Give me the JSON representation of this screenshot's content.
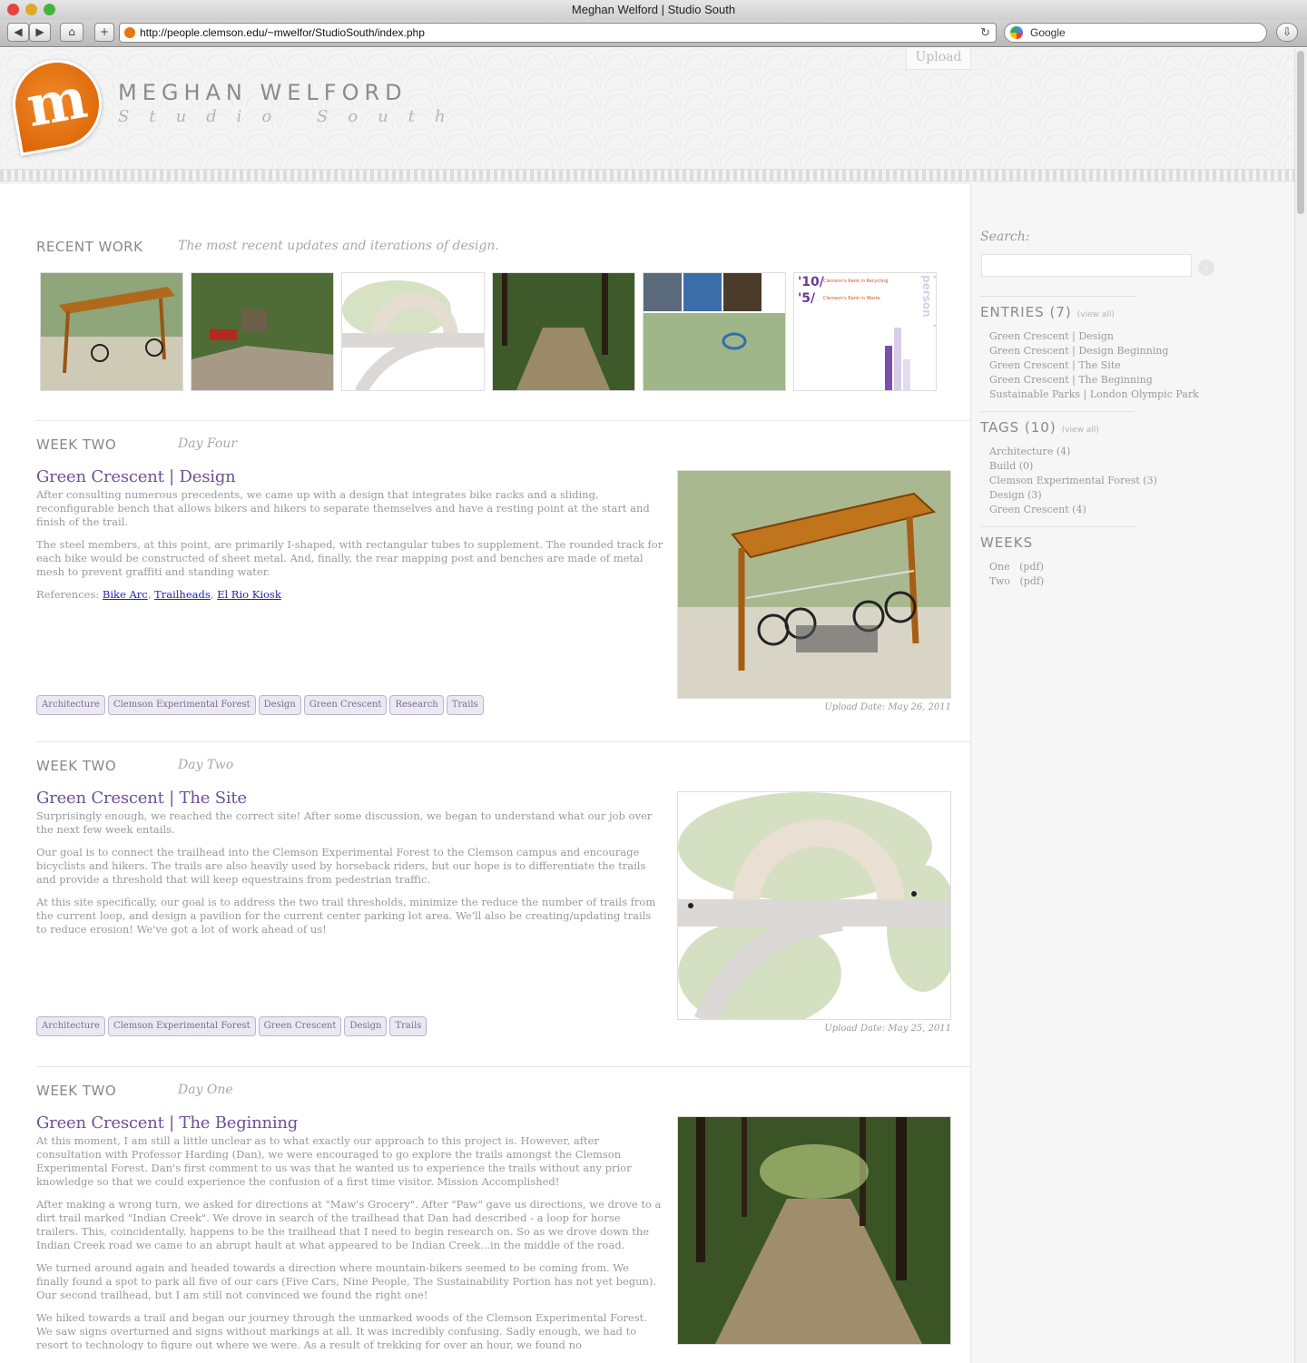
{
  "window": {
    "title": "Meghan Welford | Studio South"
  },
  "toolbar": {
    "url": "http://people.clemson.edu/~mwelfor/StudioSouth/index.php",
    "search_placeholder": "Google",
    "back": "◀",
    "fwd": "▶",
    "home": "⌂",
    "plus": "+"
  },
  "header": {
    "logo_letter": "m",
    "name": "MEGHAN WELFORD",
    "subtitle": "Studio South",
    "upload": "Upload"
  },
  "recent": {
    "title": "RECENT WORK",
    "subtitle": "The most recent updates and iterations of design."
  },
  "thumb6": {
    "line1": "'10/",
    "line1_label": "Clemson's Rank in Recycling",
    "line2": "'5/",
    "line2_label": "Clemson's Rank in Waste",
    "vertical": "pounds per person"
  },
  "posts": [
    {
      "week": "WEEK TWO",
      "day": "Day Four",
      "title": "Green Crescent | Design",
      "paras": [
        "After consulting numerous precedents, we came up with a design that integrates bike racks and a sliding, reconfigurable bench that allows bikers and hikers to separate themselves and have a resting point at the start and finish of the trail.",
        "The steel members, at this point, are primarily I-shaped, with rectangular tubes to supplement.  The rounded track for each bike would be constructed of sheet metal.  And, finally, the rear mapping post and benches are made of metal mesh to prevent graffiti and standing water."
      ],
      "refs_label": "References:",
      "refs": [
        "Bike Arc",
        "Trailheads",
        "El Rio Kiosk"
      ],
      "tags": [
        "Architecture",
        "Clemson Experimental Forest",
        "Design",
        "Green Crescent",
        "Research",
        "Trails"
      ],
      "upload_date": "Upload Date: May 26, 2011"
    },
    {
      "week": "WEEK TWO",
      "day": "Day Two",
      "title": "Green Crescent | The Site",
      "paras": [
        "Surprisingly enough, we reached the correct site!  After some discussion, we began to understand what our job over the next few week entails.",
        "Our goal is to connect the trailhead into the Clemson Experimental Forest to the Clemson campus and encourage bicyclists and hikers.  The trails are also heavily used by horseback riders, but our hope is to differentiate the trails and provide a threshold that will keep equestrains from pedestrian traffic.",
        "At this site specifically, our goal is to address the two trail thresholds, minimize the reduce the number of trails from the current loop, and design a pavilion for the current center parking lot area.  We'll also be creating/updating trails to reduce erosion!  We've got a lot of work ahead of us!"
      ],
      "tags": [
        "Architecture",
        "Clemson Experimental Forest",
        "Green Crescent",
        "Design",
        "Trails"
      ],
      "upload_date": "Upload Date: May 25, 2011"
    },
    {
      "week": "WEEK TWO",
      "day": "Day One",
      "title": "Green Crescent | The Beginning",
      "paras": [
        "At this moment, I am still a little unclear as to what exactly our approach to this project is.  However, after consultation with Professor Harding (Dan), we were encouraged to go explore the trails amongst the Clemson Experimental Forest.  Dan's first comment to us was that he wanted us to experience the trails without any prior knowledge so that we could experience the confusion of a first time visitor.  Mission Accomplished!",
        "After making a wrong turn, we asked for directions at \"Maw's Grocery\".  After \"Paw\" gave us directions, we drove to a dirt trail marked \"Indian Creek\".  We drove in search of the trailhead that Dan had described - a loop for horse trailers.  This, coincidentally, happens to be the trailhead that I need to begin research on.  So as we drove down the Indian Creek road we came to an abrupt hault at what appeared to be Indian Creek...in the middle of the road.",
        "We turned around again and headed towards a direction where mountain-bikers seemed to be coming from.  We finally found a spot to park all five of our cars (Five Cars, Nine People, The Sustainability Portion has not yet begun).  Our second trailhead, but I am still not convinced we found the right one!",
        "We hiked towards a trail and began our journey through the unmarked woods of the Clemson Experimental Forest.  We saw signs overturned and signs without markings at all.  It was incredibly confusing.  Sadly enough, we had to resort to technology to figure out where we were.  As a result of trekking for over an hour, we found no"
      ]
    }
  ],
  "sidebar": {
    "search_label": "Search:",
    "entries_title": "ENTRIES (7)",
    "entries_link": "(view all)",
    "entries": [
      "Green Crescent | Design",
      "Green Crescent | Design Beginning",
      "Green Crescent | The Site",
      "Green Crescent | The Beginning",
      "Sustainable Parks | London Olympic Park"
    ],
    "tags_title": "TAGS (10)",
    "tags_link": "(view all)",
    "tags": [
      "Architecture (4)",
      "Build (0)",
      "Clemson Experimental Forest (3)",
      "Design (3)",
      "Green Crescent (4)"
    ],
    "weeks_title": "WEEKS",
    "weeks": [
      {
        "name": "One",
        "pdf": "(pdf)"
      },
      {
        "name": "Two",
        "pdf": "(pdf)"
      }
    ]
  },
  "colors": {
    "accent": "#6e4f96",
    "logo": "#e8750f",
    "link": "#2222bb"
  }
}
